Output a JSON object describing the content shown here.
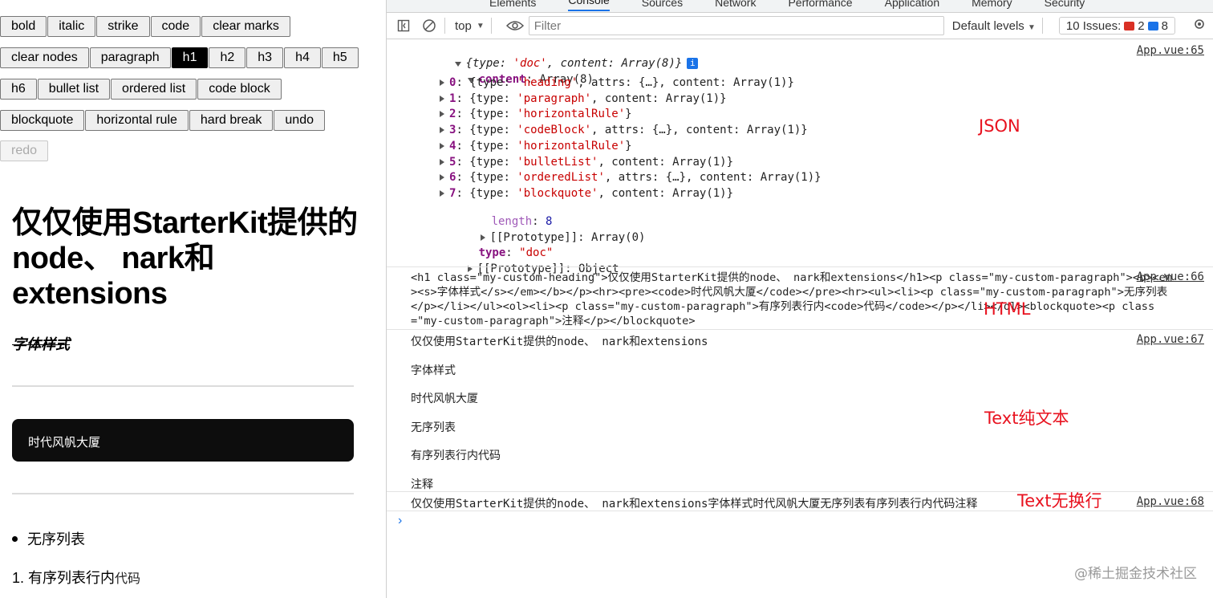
{
  "editor": {
    "toolbar_rows": [
      [
        "bold",
        "italic",
        "strike",
        "code",
        "clear marks"
      ],
      [
        "clear nodes",
        "paragraph",
        "h1",
        "h2",
        "h3",
        "h4",
        "h5"
      ],
      [
        "h6",
        "bullet list",
        "ordered list",
        "code block"
      ],
      [
        "blockquote",
        "horizontal rule",
        "hard break",
        "undo"
      ],
      [
        "redo"
      ]
    ],
    "active_button": "h1",
    "disabled_button": "redo",
    "heading": "仅仅使用StarterKit提供的node、 nark和extensions",
    "styled_text": "字体样式",
    "code_block": "时代风帆大厦",
    "bullet_item": "无序列表",
    "ordered_number": "1.",
    "ordered_text": "有序列表行内",
    "ordered_code": "代码"
  },
  "devtools": {
    "tabs": [
      "Elements",
      "Console",
      "Sources",
      "Network",
      "Performance",
      "Application",
      "Memory",
      "Security"
    ],
    "selected_tab": "Console",
    "context": "top",
    "filter_placeholder": "Filter",
    "levels": "Default levels",
    "issues_label": "10 Issues:",
    "issues_errors": "2",
    "issues_info": "8",
    "json_log": {
      "source": "App.vue:65",
      "summary_open": "{type: ",
      "summary_type": "'doc'",
      "summary_mid": ", content: ",
      "summary_end": "Array(8)}",
      "content_key": "content",
      "content_val": "Array(8)",
      "items": [
        {
          "idx": "0",
          "type": "'heading'",
          "rest": ", attrs: {…}, content: Array(1)}"
        },
        {
          "idx": "1",
          "type": "'paragraph'",
          "rest": ", content: Array(1)}"
        },
        {
          "idx": "2",
          "type": "'horizontalRule'",
          "rest": "}"
        },
        {
          "idx": "3",
          "type": "'codeBlock'",
          "rest": ", attrs: {…}, content: Array(1)}"
        },
        {
          "idx": "4",
          "type": "'horizontalRule'",
          "rest": "}"
        },
        {
          "idx": "5",
          "type": "'bulletList'",
          "rest": ", content: Array(1)}"
        },
        {
          "idx": "6",
          "type": "'orderedList'",
          "rest": ", attrs: {…}, content: Array(1)}"
        },
        {
          "idx": "7",
          "type": "'blockquote'",
          "rest": ", content: Array(1)}"
        }
      ],
      "length_key": "length",
      "length_val": "8",
      "proto_array": "[[Prototype]]: Array(0)",
      "type_key": "type",
      "type_val": "\"doc\"",
      "proto_object": "[[Prototype]]: Object"
    },
    "html_log": {
      "source": "App.vue:66",
      "text": "<h1 class=\"my-custom-heading\">仅仅使用StarterKit提供的node、 nark和extensions</h1><p class=\"my-custom-paragraph\"><b><em><s>字体样式</s></em></b></p><hr><pre><code>时代风帆大厦</code></pre><hr><ul><li><p class=\"my-custom-paragraph\">无序列表</p></li></ul><ol><li><p class=\"my-custom-paragraph\">有序列表行内<code>代码</code></p></li></ol><blockquote><p class=\"my-custom-paragraph\">注释</p></blockquote>"
    },
    "text_log": {
      "source": "App.vue:67",
      "lines": [
        "仅仅使用StarterKit提供的node、 nark和extensions",
        "字体样式",
        "时代风帆大厦",
        "无序列表",
        "有序列表行内代码",
        "注释"
      ]
    },
    "text_nobreak_log": {
      "source": "App.vue:68",
      "text": "仅仅使用StarterKit提供的node、 nark和extensions字体样式时代风帆大厦无序列表有序列表行内代码注释"
    },
    "annotations": {
      "json": "JSON",
      "html": "HTML",
      "text": "Text纯文本",
      "text_nobreak": "Text无换行"
    },
    "prompt": "›"
  },
  "watermark": "@稀土掘金技术社区"
}
